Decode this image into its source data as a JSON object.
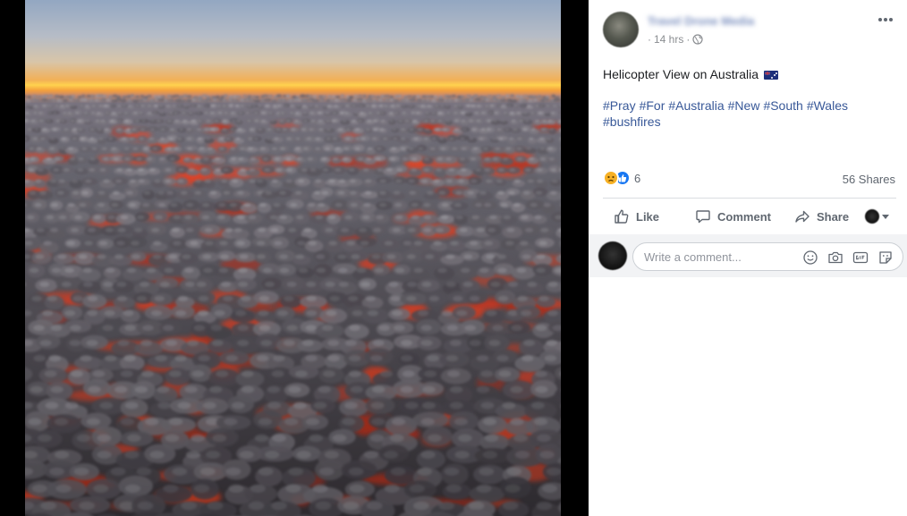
{
  "post": {
    "author": "Travel Drone Media",
    "time": "14 hrs",
    "time_sep": "·",
    "caption": "Helicopter View on Australia",
    "hashtags": [
      "#Pray",
      "#For",
      "#Australia",
      "#New",
      "#South",
      "#Wales",
      "#bushfires"
    ],
    "reaction_count": "6",
    "shares": "56 Shares"
  },
  "actions": {
    "like": "Like",
    "comment": "Comment",
    "share": "Share"
  },
  "comment_box": {
    "placeholder": "Write a comment..."
  },
  "icons": {
    "privacy": "globe-icon",
    "more": "more-options-icon",
    "reactions": [
      "sad-reaction-icon",
      "like-reaction-icon"
    ],
    "composer": [
      "emoji-icon",
      "camera-icon",
      "gif-icon",
      "sticker-icon"
    ]
  },
  "colors": {
    "link": "#385898",
    "muted": "#606770",
    "like_blue": "#1877f2"
  }
}
